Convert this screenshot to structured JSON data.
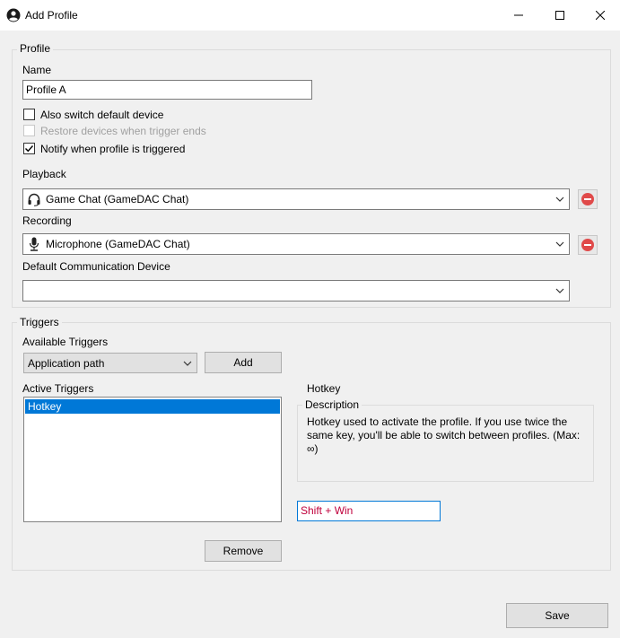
{
  "window": {
    "title": "Add Profile",
    "icon": "user-circle-icon"
  },
  "profile_group": {
    "legend": "Profile",
    "name_label": "Name",
    "name_value": "Profile A",
    "checkbox_switch_default": {
      "label": "Also switch default device",
      "checked": false
    },
    "checkbox_restore": {
      "label": "Restore devices when trigger ends",
      "checked": false,
      "disabled": true
    },
    "checkbox_notify": {
      "label": "Notify when profile is triggered",
      "checked": true
    },
    "playback_label": "Playback",
    "playback_value": "Game Chat (GameDAC Chat)",
    "recording_label": "Recording",
    "recording_value": "Microphone (GameDAC Chat)",
    "default_comm_label": "Default Communication Device",
    "default_comm_value": ""
  },
  "triggers_group": {
    "legend": "Triggers",
    "available_label": "Available Triggers",
    "available_value": "Application path",
    "add_button": "Add",
    "active_label": "Active Triggers",
    "active_items": [
      "Hotkey"
    ],
    "detail_title": "Hotkey",
    "description_legend": "Description",
    "description_text": "Hotkey used to activate the profile. If you use twice the same key, you'll be able to switch between profiles. (Max: ∞)",
    "hotkey_value": "Shift + Win",
    "remove_button": "Remove"
  },
  "save_button": "Save",
  "colors": {
    "selection": "#0078d7",
    "hotkey_text": "#c0003c",
    "remove_icon": "#e04a4a"
  }
}
